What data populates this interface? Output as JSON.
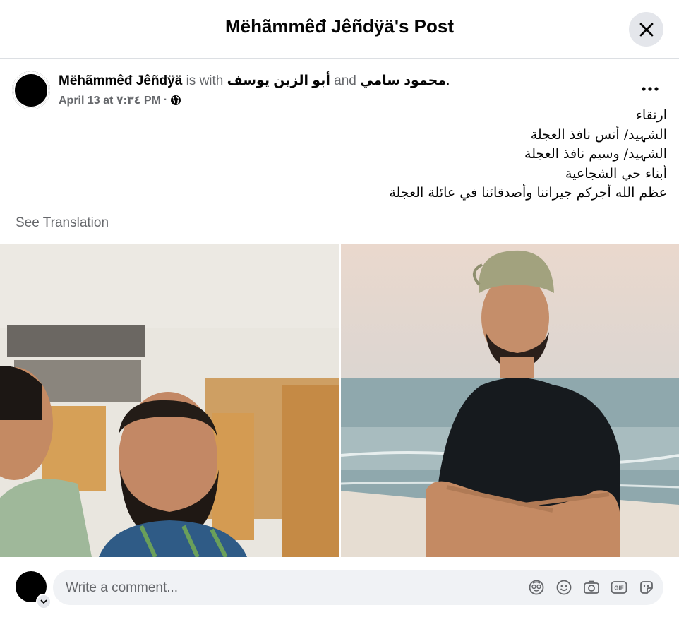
{
  "header": {
    "title": "Mëhãmmêđ Jêñdÿä's Post"
  },
  "post": {
    "author": "Mëhãmmêđ Jêñdÿä",
    "with_text": "is with",
    "tagged_1": "أبو الزين يوسف",
    "and_text": "and",
    "tagged_2": "محمود سامي",
    "end_punct": ".",
    "date": "April 13 at ٧:٣٤ PM",
    "separator": "·",
    "lines": [
      "ارتقاء",
      "الشہيد/ أنس نافذ العجلة",
      "الشہيد/ وسيم نافذ العجلة",
      "أبناء حي الشجاعية",
      "عظم الله أجركم جيراننا وأصدقائنا في عائلة العجلة"
    ],
    "see_translation": "See Translation"
  },
  "comment": {
    "placeholder": "Write a comment..."
  },
  "icons": {
    "close": "close-icon",
    "more": "more-icon",
    "privacy": "globe-icon",
    "comment_tools": [
      "avatar-sticker-icon",
      "emoji-icon",
      "camera-icon",
      "gif-icon",
      "sticker-icon"
    ]
  },
  "colors": {
    "header_close_bg": "#e4e6eb",
    "secondary_text": "#65676b",
    "input_bg": "#f0f2f5"
  }
}
